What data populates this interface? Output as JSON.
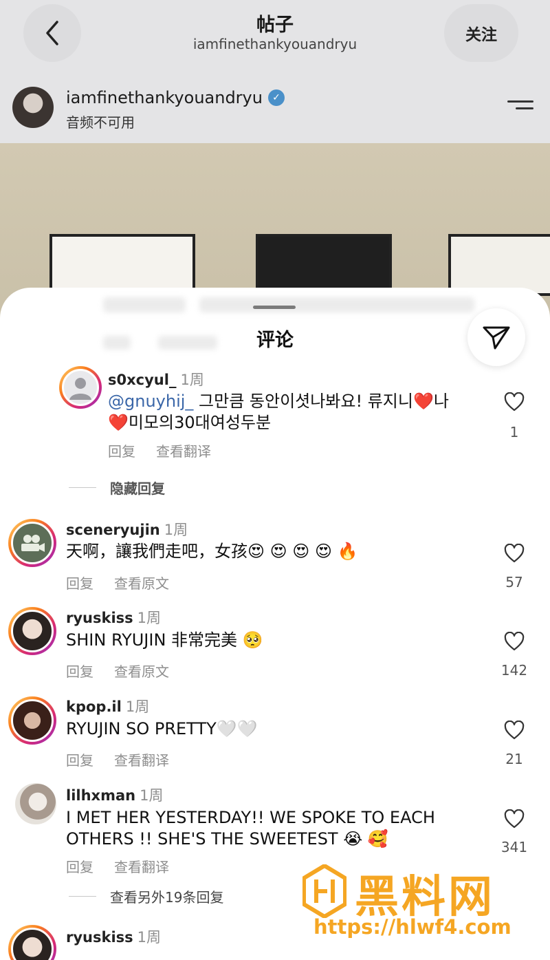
{
  "header": {
    "title": "帖子",
    "subtitle": "iamfinethankyouandryu",
    "follow_label": "关注"
  },
  "post": {
    "username": "iamfinethankyouandryu",
    "verified": "✓",
    "audio": "音频不可用"
  },
  "sheet": {
    "title": "评论"
  },
  "comments": [
    {
      "username": "s0xcyul_",
      "time": "1周",
      "mention": "@gnuyhij_",
      "line1": " 그만큼 동안이셧나봐요! 류지니",
      "line1_emoji": "❤️",
      "line1_tail": "나",
      "line2_emoji": "❤️",
      "line2": "미모의30대여성두분",
      "reply": "回复",
      "translate": "查看翻译",
      "likes": "1",
      "hidden_replies": "隐藏回复"
    },
    {
      "username": "sceneryujin",
      "time": "1周",
      "text": "天啊，讓我們走吧，女孩",
      "emoji": "😍 😍 😍 😍 🔥",
      "reply": "回复",
      "translate": "查看原文",
      "likes": "57"
    },
    {
      "username": "ryuskiss",
      "time": "1周",
      "text": "SHIN RYUJIN 非常完美",
      "emoji": "🥺",
      "reply": "回复",
      "translate": "查看原文",
      "likes": "142"
    },
    {
      "username": "kpop.il",
      "time": "1周",
      "text": "RYUJIN SO PRETTY",
      "emoji": "🤍🤍",
      "reply": "回复",
      "translate": "查看翻译",
      "likes": "21"
    },
    {
      "username": "lilhxman",
      "time": "1周",
      "line1": "I MET HER YESTERDAY!! WE SPOKE TO EACH",
      "line2": "OTHERS !! SHE'S THE SWEETEST",
      "emoji": "😭 🥰",
      "reply": "回复",
      "translate": "查看翻译",
      "likes": "341",
      "more_replies": "查看另外19条回复"
    },
    {
      "username": "ryuskiss",
      "time": "1周"
    }
  ],
  "watermark": {
    "text": "黑料网",
    "url": "https://hlwf4.com"
  }
}
